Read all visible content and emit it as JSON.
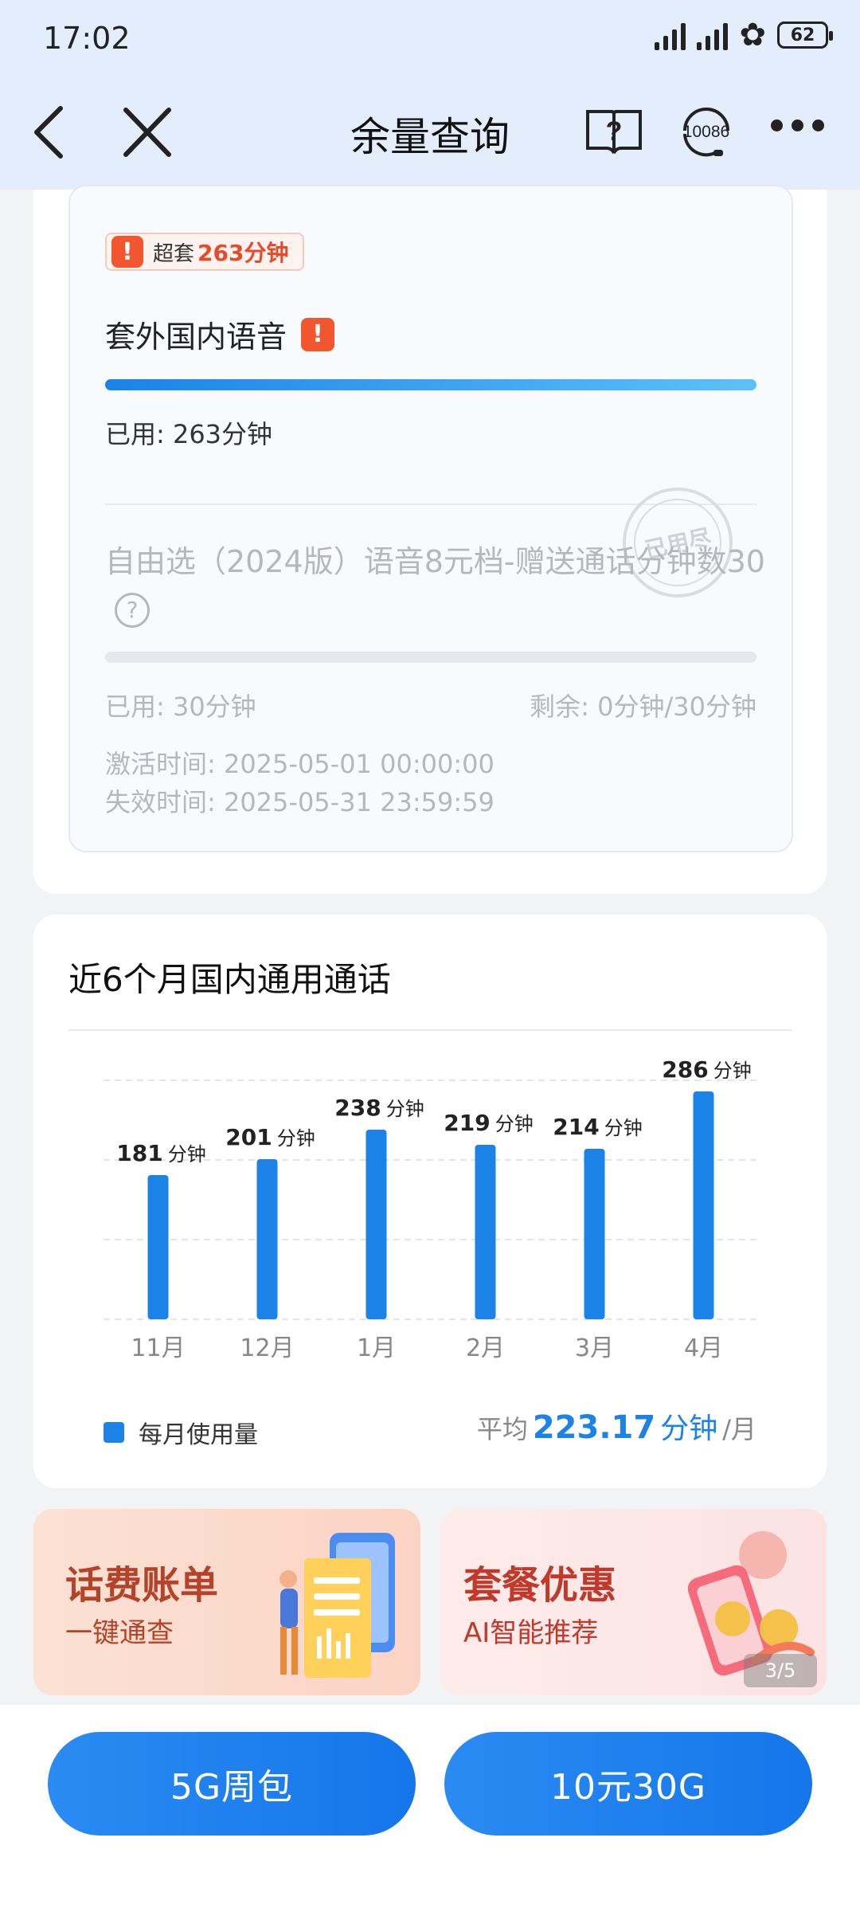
{
  "status_bar": {
    "time": "17:02",
    "battery": "62"
  },
  "header": {
    "title": "余量查询",
    "service_number": "10086"
  },
  "overage_item": {
    "badge_label": "超套",
    "badge_value": "263分钟",
    "title": "套外国内语音",
    "used": "已用: 263分钟"
  },
  "package_item": {
    "stamp_text": "已用尽",
    "name": "自由选（2024版）语音8元档-赠送通话分钟数30",
    "used": "已用: 30分钟",
    "remaining": "剩余: 0分钟/30分钟",
    "activated": "激活时间: 2025-05-01 00:00:00",
    "expires": "失效时间: 2025-05-31 23:59:59",
    "usage_ratio": 1.0
  },
  "chart_section": {
    "title": "近6个月国内通用通话",
    "legend_label": "每月使用量",
    "average_label": "平均",
    "average_value": "223.17",
    "average_unit": "分钟",
    "average_suffix": "/月"
  },
  "chart_data": {
    "type": "bar",
    "categories": [
      "11月",
      "12月",
      "1月",
      "2月",
      "3月",
      "4月"
    ],
    "values": [
      181,
      201,
      238,
      219,
      214,
      286
    ],
    "value_unit": "分钟",
    "color": "#1b82e8",
    "grid": true,
    "legend_position": "bottom-left"
  },
  "promos": [
    {
      "title": "话费账单",
      "subtitle": "一键通查"
    },
    {
      "title": "套餐优惠",
      "subtitle": "AI智能推荐",
      "page_indicator": "3/5"
    }
  ],
  "buttons": {
    "left": "5G周包",
    "right": "10元30G"
  },
  "colors": {
    "accent": "#1b82e8",
    "warning": "#f2562f",
    "header_bg": "#e3edfb"
  }
}
